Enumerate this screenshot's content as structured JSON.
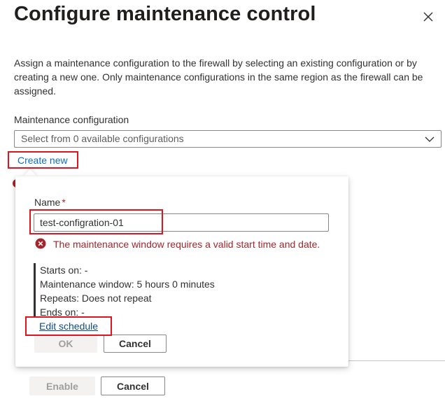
{
  "panel": {
    "title": "Configure maintenance control",
    "description": "Assign a maintenance configuration to the firewall by selecting an existing configuration or by creating a new one. Only maintenance configurations in the same region as the firewall can be assigned.",
    "field_label": "Maintenance configuration",
    "dropdown_placeholder": "Select from 0 available configurations",
    "create_new_label": "Create new",
    "enable_label": "Enable",
    "cancel_label": "Cancel"
  },
  "callout": {
    "name_label": "Name",
    "required_marker": "*",
    "name_value": "test-configration-01",
    "error_message": "The maintenance window requires a valid start time and date.",
    "starts_on": "Starts on: -",
    "maintenance_window": "Maintenance window: 5 hours 0 minutes",
    "repeats": "Repeats: Does not repeat",
    "ends_on": "Ends on: -",
    "edit_schedule_label": "Edit schedule",
    "ok_label": "OK",
    "cancel_label": "Cancel"
  },
  "colors": {
    "accent_link": "#0f6cbd",
    "error": "#a4262c",
    "highlight": "#e0141e"
  },
  "icons": {
    "close": "close-icon",
    "dropdown": "chevron-down-icon",
    "error": "error-circle-icon"
  }
}
